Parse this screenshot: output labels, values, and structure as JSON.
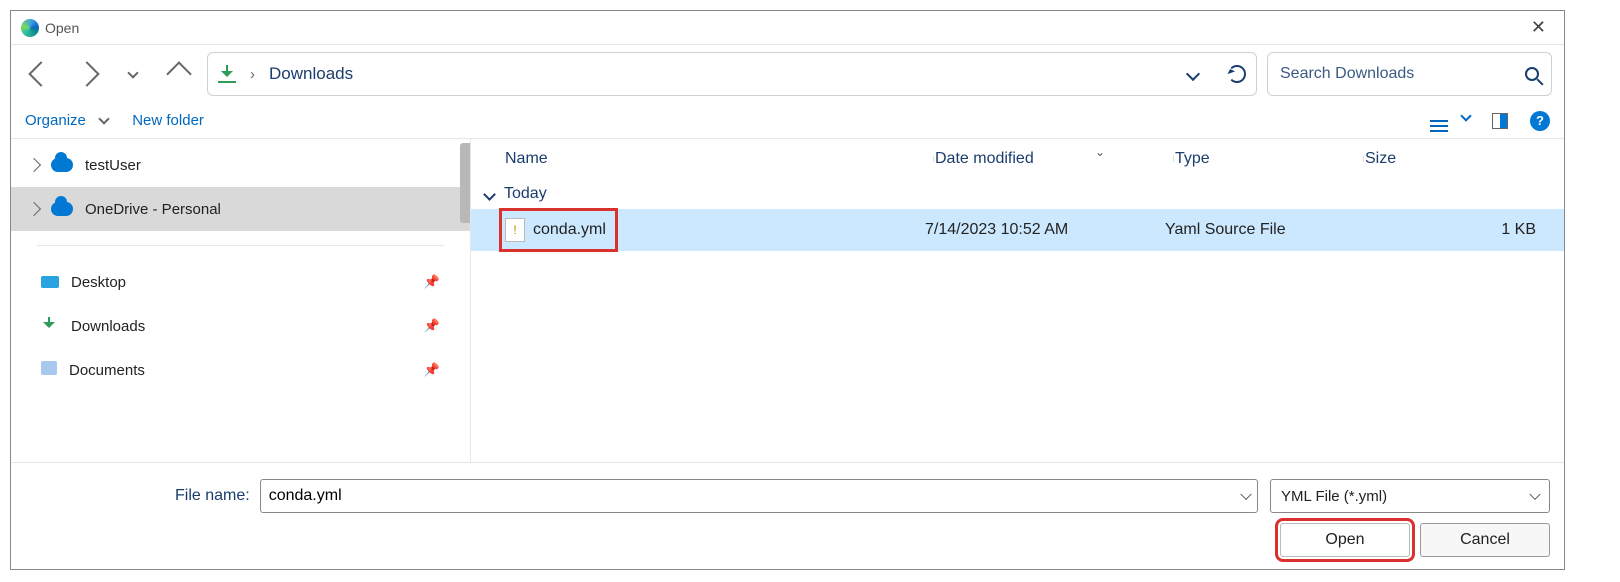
{
  "window": {
    "title": "Open"
  },
  "location": {
    "current": "Downloads"
  },
  "search": {
    "placeholder": "Search Downloads"
  },
  "toolbar": {
    "organize": "Organize",
    "new_folder": "New folder"
  },
  "sidebar": {
    "tree": [
      {
        "label": "testUser",
        "icon": "cloud",
        "selected": false
      },
      {
        "label": "OneDrive - Personal",
        "icon": "cloud",
        "selected": true
      }
    ],
    "quick": [
      {
        "label": "Desktop",
        "icon": "desktop"
      },
      {
        "label": "Downloads",
        "icon": "downloads"
      },
      {
        "label": "Documents",
        "icon": "documents"
      }
    ]
  },
  "columns": {
    "name": "Name",
    "modified": "Date modified",
    "type": "Type",
    "size": "Size"
  },
  "group": {
    "label": "Today"
  },
  "rows": [
    {
      "name": "conda.yml",
      "modified": "7/14/2023 10:52 AM",
      "type": "Yaml Source File",
      "size": "1 KB",
      "selected": true,
      "highlight": true
    }
  ],
  "footer": {
    "file_name_label": "File name:",
    "file_name_value": "conda.yml",
    "type_filter": "YML File (*.yml)",
    "open": "Open",
    "cancel": "Cancel"
  }
}
